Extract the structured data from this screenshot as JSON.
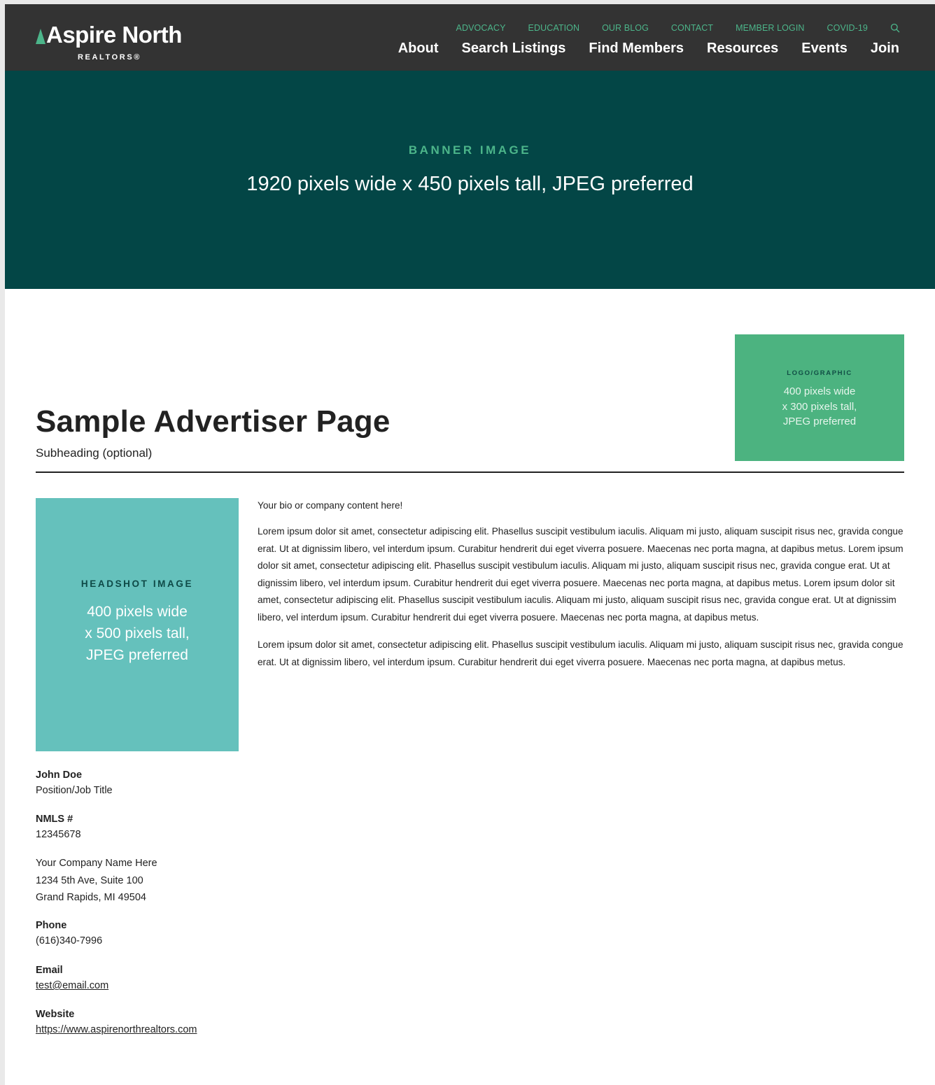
{
  "header": {
    "logo_text": "Aspire North",
    "logo_sub": "REALTORS®",
    "utility_nav": [
      "ADVOCACY",
      "EDUCATION",
      "OUR BLOG",
      "CONTACT",
      "MEMBER LOGIN",
      "COVID-19"
    ],
    "search_icon": "search-icon",
    "main_nav": [
      "About",
      "Search Listings",
      "Find Members",
      "Resources",
      "Events",
      "Join"
    ]
  },
  "banner": {
    "label": "BANNER IMAGE",
    "subtitle": "1920 pixels wide x 450 pixels tall, JPEG preferred"
  },
  "page": {
    "title": "Sample Advertiser Page",
    "subtitle": "Subheading (optional)"
  },
  "logo_graphic": {
    "label": "LOGO/GRAPHIC",
    "lines": [
      "400 pixels wide",
      "x 300 pixels tall,",
      "JPEG preferred"
    ]
  },
  "headshot": {
    "label": "HEADSHOT IMAGE",
    "lines": [
      "400 pixels wide",
      "x 500 pixels tall,",
      "JPEG preferred"
    ]
  },
  "contact": {
    "name": "John Doe",
    "position": "Position/Job Title",
    "nmls_label": "NMLS #",
    "nmls_value": "12345678",
    "address": [
      "Your Company Name Here",
      "1234 5th Ave, Suite 100",
      "Grand Rapids, MI 49504"
    ],
    "phone_label": "Phone",
    "phone_value": "(616)340-7996",
    "email_label": "Email",
    "email_value": "test@email.com",
    "website_label": "Website",
    "website_value": "https://www.aspirenorthrealtors.com"
  },
  "bio": {
    "intro": "Your bio or company content here!",
    "paragraphs": [
      "Lorem ipsum dolor sit amet, consectetur adipiscing elit. Phasellus suscipit vestibulum iaculis. Aliquam mi justo, aliquam suscipit risus nec, gravida congue erat. Ut at dignissim libero, vel interdum ipsum. Curabitur hendrerit dui eget viverra posuere. Maecenas nec porta magna, at dapibus metus. Lorem ipsum dolor sit amet, consectetur adipiscing elit. Phasellus suscipit vestibulum iaculis. Aliquam mi justo, aliquam suscipit risus nec, gravida congue erat. Ut at dignissim libero, vel interdum ipsum. Curabitur hendrerit dui eget viverra posuere. Maecenas nec porta magna, at dapibus metus. Lorem ipsum dolor sit amet, consectetur adipiscing elit. Phasellus suscipit vestibulum iaculis. Aliquam mi justo, aliquam suscipit risus nec, gravida congue erat. Ut at dignissim libero, vel interdum ipsum. Curabitur hendrerit dui eget viverra posuere. Maecenas nec porta magna, at dapibus metus.",
      "Lorem ipsum dolor sit amet, consectetur adipiscing elit. Phasellus suscipit vestibulum iaculis. Aliquam mi justo, aliquam suscipit risus nec, gravida congue erat. Ut at dignissim libero, vel interdum ipsum. Curabitur hendrerit dui eget viverra posuere. Maecenas nec porta magna, at dapibus metus."
    ]
  },
  "colors": {
    "header_bg": "#333333",
    "banner_bg": "#034646",
    "accent_green": "#4cb58a",
    "logo_graphic_bg": "#4cb380",
    "headshot_bg": "#65c1bc"
  }
}
